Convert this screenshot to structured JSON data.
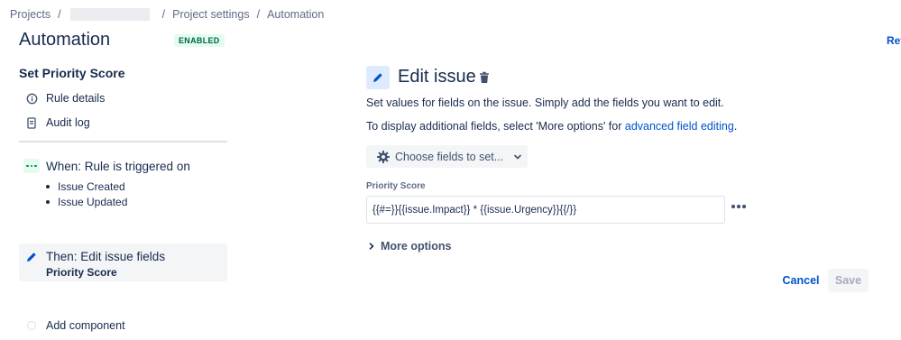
{
  "breadcrumb": {
    "projects": "Projects",
    "project_settings": "Project settings",
    "current": "Automation"
  },
  "header": {
    "title": "Automation",
    "status_badge": "ENABLED",
    "top_right_link": "Ret"
  },
  "sidebar": {
    "rule_name": "Set Priority Score",
    "items": [
      {
        "label": "Rule details",
        "icon": "info-icon"
      },
      {
        "label": "Audit log",
        "icon": "document-icon"
      }
    ],
    "trigger": {
      "title": "When: Rule is triggered on",
      "events": [
        "Issue Created",
        "Issue Updated"
      ]
    },
    "action": {
      "title": "Then: Edit issue fields",
      "subtitle": "Priority Score"
    },
    "add_component": "Add component"
  },
  "main": {
    "title": "Edit issue",
    "description": "Set values for fields on the issue. Simply add the fields you want to edit.",
    "description2_prefix": "To display additional fields, select 'More options' for ",
    "description2_link": "advanced field editing",
    "description2_suffix": ".",
    "choose_fields_button": "Choose fields to set...",
    "field": {
      "label": "Priority Score",
      "value": "{{#=}}{{issue.Impact}} * {{issue.Urgency}}{{/}}"
    },
    "more_options": "More options",
    "cancel": "Cancel",
    "save": "Save"
  },
  "colors": {
    "link": "#0052cc",
    "text": "#172b4d",
    "badge_bg": "#e3fcef",
    "badge_text": "#006644",
    "edit_icon_bg": "#deebff"
  }
}
